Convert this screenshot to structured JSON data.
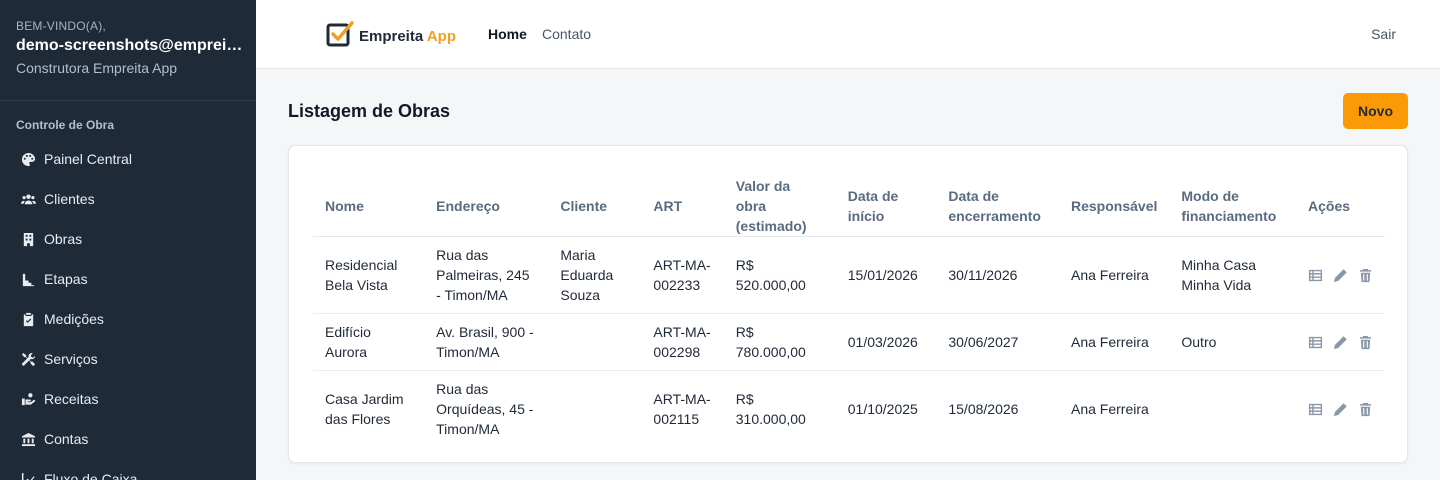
{
  "sidebar": {
    "welcome": "BEM-VINDO(A),",
    "email": "demo-screenshots@empreita...",
    "company": "Construtora Empreita App",
    "section": "Controle de Obra",
    "items": [
      {
        "label": "Painel Central",
        "icon": "palette-icon"
      },
      {
        "label": "Clientes",
        "icon": "users-icon"
      },
      {
        "label": "Obras",
        "icon": "building-icon"
      },
      {
        "label": "Etapas",
        "icon": "stairs-icon"
      },
      {
        "label": "Medições",
        "icon": "clipboard-check-icon"
      },
      {
        "label": "Serviços",
        "icon": "tools-icon"
      },
      {
        "label": "Receitas",
        "icon": "hand-coins-icon"
      },
      {
        "label": "Contas",
        "icon": "bank-icon"
      },
      {
        "label": "Fluxo de Caixa",
        "icon": "chart-line-icon"
      }
    ]
  },
  "topnav": {
    "brand_main": "Empreita",
    "brand_accent": "App",
    "home": "Home",
    "contato": "Contato",
    "sair": "Sair"
  },
  "main": {
    "title": "Listagem de Obras",
    "new_button": "Novo",
    "columns": [
      "Nome",
      "Endereço",
      "Cliente",
      "ART",
      "Valor da obra (estimado)",
      "Data de início",
      "Data de encerramento",
      "Responsável",
      "Modo de financiamento",
      "Ações"
    ],
    "rows": [
      {
        "nome": "Residencial Bela Vista",
        "endereco": "Rua das Palmeiras, 245 - Timon/MA",
        "cliente": "Maria Eduarda Souza",
        "art": "ART-MA-002233",
        "valor": "R$ 520.000,00",
        "inicio": "15/01/2026",
        "encerramento": "30/11/2026",
        "responsavel": "Ana Ferreira",
        "financiamento": "Minha Casa Minha Vida"
      },
      {
        "nome": "Edifício Aurora",
        "endereco": "Av. Brasil, 900 - Timon/MA",
        "cliente": "",
        "art": "ART-MA-002298",
        "valor": "R$ 780.000,00",
        "inicio": "01/03/2026",
        "encerramento": "30/06/2027",
        "responsavel": "Ana Ferreira",
        "financiamento": "Outro"
      },
      {
        "nome": "Casa Jardim das Flores",
        "endereco": "Rua das Orquídeas, 45 - Timon/MA",
        "cliente": "",
        "art": "ART-MA-002115",
        "valor": "R$ 310.000,00",
        "inicio": "01/10/2025",
        "encerramento": "15/08/2026",
        "responsavel": "Ana Ferreira",
        "financiamento": ""
      }
    ]
  },
  "colors": {
    "sidebar_bg": "#1e2a38",
    "accent": "#fb9a06",
    "logo_accent": "#f0a020"
  }
}
